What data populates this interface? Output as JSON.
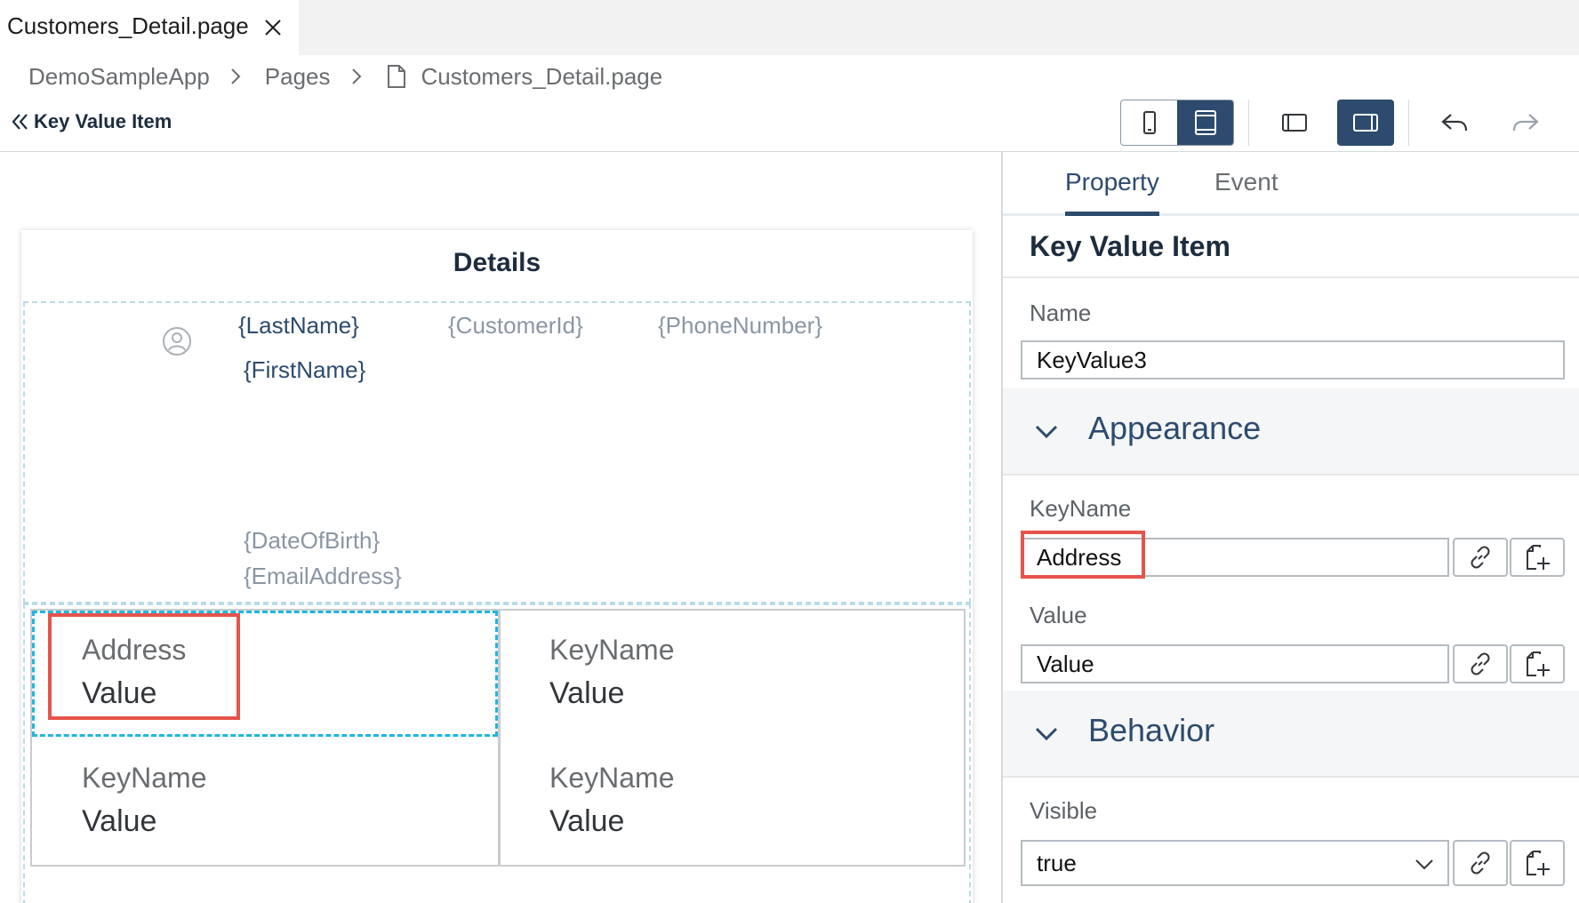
{
  "file_tab": {
    "label": "Customers_Detail.page"
  },
  "breadcrumb": {
    "items": [
      "DemoSampleApp",
      "Pages",
      "Customers_Detail.page"
    ]
  },
  "header": {
    "back_title": "Key Value Item"
  },
  "canvas": {
    "section_title": "Details",
    "object_header": {
      "last_name": "{LastName}",
      "first_name": "{FirstName}",
      "customer_id": "{CustomerId}",
      "phone_number": "{PhoneNumber}",
      "date_of_birth": "{DateOfBirth}",
      "email_address": "{EmailAddress}"
    },
    "key_values": [
      {
        "key": "Address",
        "value": "Value"
      },
      {
        "key": "KeyName",
        "value": "Value"
      },
      {
        "key": "KeyName",
        "value": "Value"
      },
      {
        "key": "KeyName",
        "value": "Value"
      }
    ]
  },
  "panel": {
    "tabs": [
      "Property",
      "Event"
    ],
    "title": "Key Value Item",
    "name_label": "Name",
    "name_value": "KeyValue3",
    "appearance_label": "Appearance",
    "keyname_label": "KeyName",
    "keyname_value": "Address",
    "value_label": "Value",
    "value_value": "Value",
    "behavior_label": "Behavior",
    "visible_label": "Visible",
    "visible_value": "true"
  },
  "colors": {
    "accent": "#2c4b6e",
    "highlight": "#e5544b",
    "selection": "#1fb6e0"
  },
  "icons": [
    "close-icon",
    "chevron-right-icon",
    "file-icon",
    "double-chevron-left-icon",
    "phone-icon",
    "tablet-icon",
    "panel-left-icon",
    "panel-right-icon",
    "undo-icon",
    "redo-icon",
    "avatar-icon",
    "chevron-down-icon",
    "link-icon",
    "new-object-icon"
  ]
}
